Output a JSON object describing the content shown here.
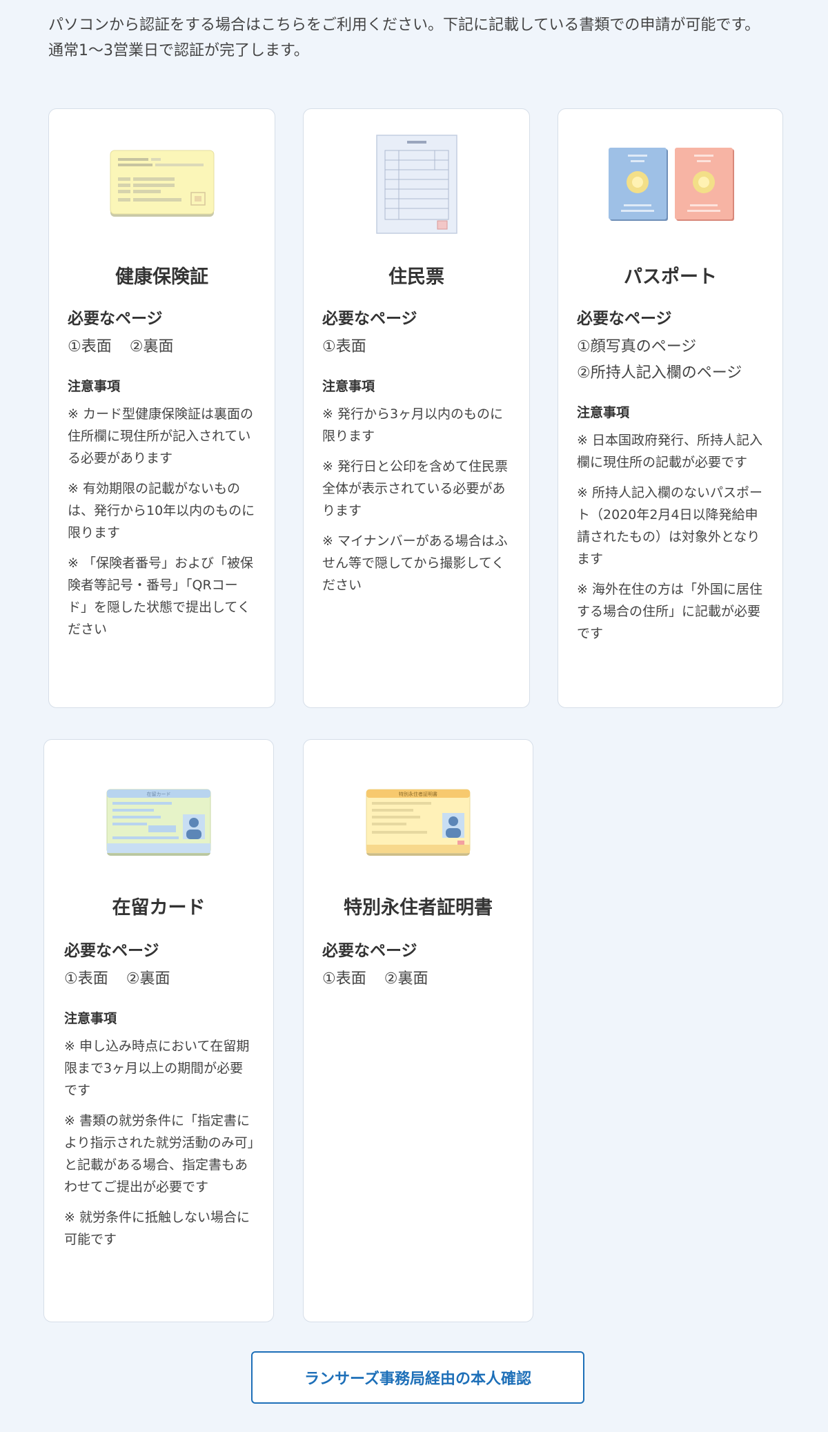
{
  "intro": {
    "line1": "パソコンから認証をする場合はこちらをご利用ください。下記に記載している書類での申請が可能です。",
    "line2": "通常1〜3営業日で認証が完了します。"
  },
  "cards": {
    "insurance": {
      "title": "健康保険証",
      "illustration": "health-insurance-card-icon",
      "pages_heading": "必要なページ",
      "pages": [
        "①表面",
        "②裏面"
      ],
      "notes_heading": "注意事項",
      "notes": [
        "※ カード型健康保険証は裏面の住所欄に現住所が記入されている必要があります",
        "※ 有効期限の記載がないものは、発行から10年以内のものに限ります",
        "※ 「保険者番号」および「被保険者等記号・番号」「QRコード」を隠した状態で提出してください"
      ]
    },
    "resident": {
      "title": "住民票",
      "illustration": "resident-certificate-icon",
      "pages_heading": "必要なページ",
      "pages": [
        "①表面"
      ],
      "notes_heading": "注意事項",
      "notes": [
        "※ 発行から3ヶ月以内のものに限ります",
        "※ 発行日と公印を含めて住民票全体が表示されている必要があります",
        "※ マイナンバーがある場合はふせん等で隠してから撮影してください"
      ]
    },
    "passport": {
      "title": "パスポート",
      "illustration": "passport-icon",
      "pages_heading": "必要なページ",
      "pages": [
        "①顔写真のページ",
        "②所持人記入欄のページ"
      ],
      "notes_heading": "注意事項",
      "notes": [
        "※ 日本国政府発行、所持人記入欄に現住所の記載が必要です",
        "※ 所持人記入欄のないパスポート（2020年2月4日以降発給申請されたもの）は対象外となります",
        "※ 海外在住の方は「外国に居住する場合の住所」に記載が必要です"
      ]
    },
    "residence": {
      "title": "在留カード",
      "illustration": "residence-card-icon",
      "card_label": "在留カード",
      "pages_heading": "必要なページ",
      "pages": [
        "①表面",
        "②裏面"
      ],
      "notes_heading": "注意事項",
      "notes": [
        "※ 申し込み時点において在留期限まで3ヶ月以上の期間が必要です",
        "※ 書類の就労条件に「指定書により指示された就労活動のみ可」と記載がある場合、指定書もあわせてご提出が必要です",
        "※ 就労条件に抵触しない場合に可能です"
      ]
    },
    "special": {
      "title": "特別永住者証明書",
      "illustration": "special-permanent-resident-card-icon",
      "card_label": "特別永住者証明書",
      "pages_heading": "必要なページ",
      "pages": [
        "①表面",
        "②裏面"
      ]
    }
  },
  "cta": {
    "label": "ランサーズ事務局経由の本人確認"
  },
  "colors": {
    "accent": "#1d6fb8",
    "background": "#f0f5fb",
    "card_border": "#d6dee8"
  }
}
